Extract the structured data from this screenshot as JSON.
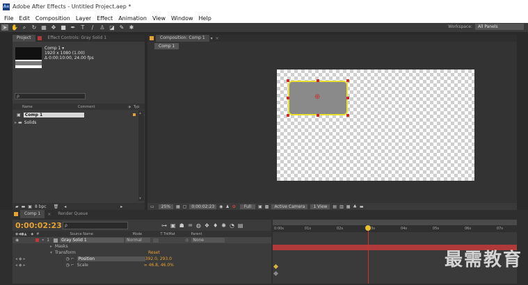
{
  "window": {
    "title": "Adobe After Effects - Untitled Project.aep *",
    "app_icon": "Ae"
  },
  "menu": [
    "File",
    "Edit",
    "Composition",
    "Layer",
    "Effect",
    "Animation",
    "View",
    "Window",
    "Help"
  ],
  "toolbar": {
    "workspace_label": "Workspace:",
    "workspace_value": "All Panels"
  },
  "project": {
    "tab_project": "Project",
    "tab_effect_controls": "Effect Controls: Gray Solid 1",
    "comp_name": "Comp 1 ▾",
    "comp_size": "1920 x 1080 (1.00)",
    "comp_duration": "Δ 0:00:10:00, 24.00 fps",
    "search_placeholder": "ρ",
    "columns": {
      "name": "Name",
      "comment": "Comment",
      "type": "Typ"
    },
    "items": [
      {
        "name": "Comp 1",
        "color": "#e8a230"
      },
      {
        "name": "Solids",
        "color": "#e8d23a"
      }
    ],
    "bpc": "8 bpc"
  },
  "composition": {
    "tab": "Composition: Comp 1",
    "subtab": "Comp 1",
    "zoom": "25%",
    "timecode": "0:00:02:23",
    "resolution": "Full",
    "camera": "Active Camera",
    "views": "1 View"
  },
  "timeline": {
    "tab_comp": "Comp 1",
    "tab_render": "Render Queue",
    "timecode": "0:00:02:23",
    "search_placeholder": "ρ",
    "columns": {
      "source": "Source Name",
      "mode": "Mode",
      "trkmat": "T  TrkMat",
      "parent": "Parent"
    },
    "layer": {
      "num": "1",
      "name": "Gray Solid 1",
      "mode": "Normal",
      "parent": "None"
    },
    "masks": "Masks",
    "transform": "Transform",
    "reset": "Reset",
    "position_label": "Position",
    "position_value": "392.0, 293.0",
    "scale_label": "Scale",
    "scale_value": "∞ 46.8, 46.0%",
    "ruler": [
      "0:00s",
      "01s",
      "02s",
      "03s",
      "04s",
      "05s",
      "06s",
      "07s"
    ]
  },
  "watermark": "最需教育"
}
